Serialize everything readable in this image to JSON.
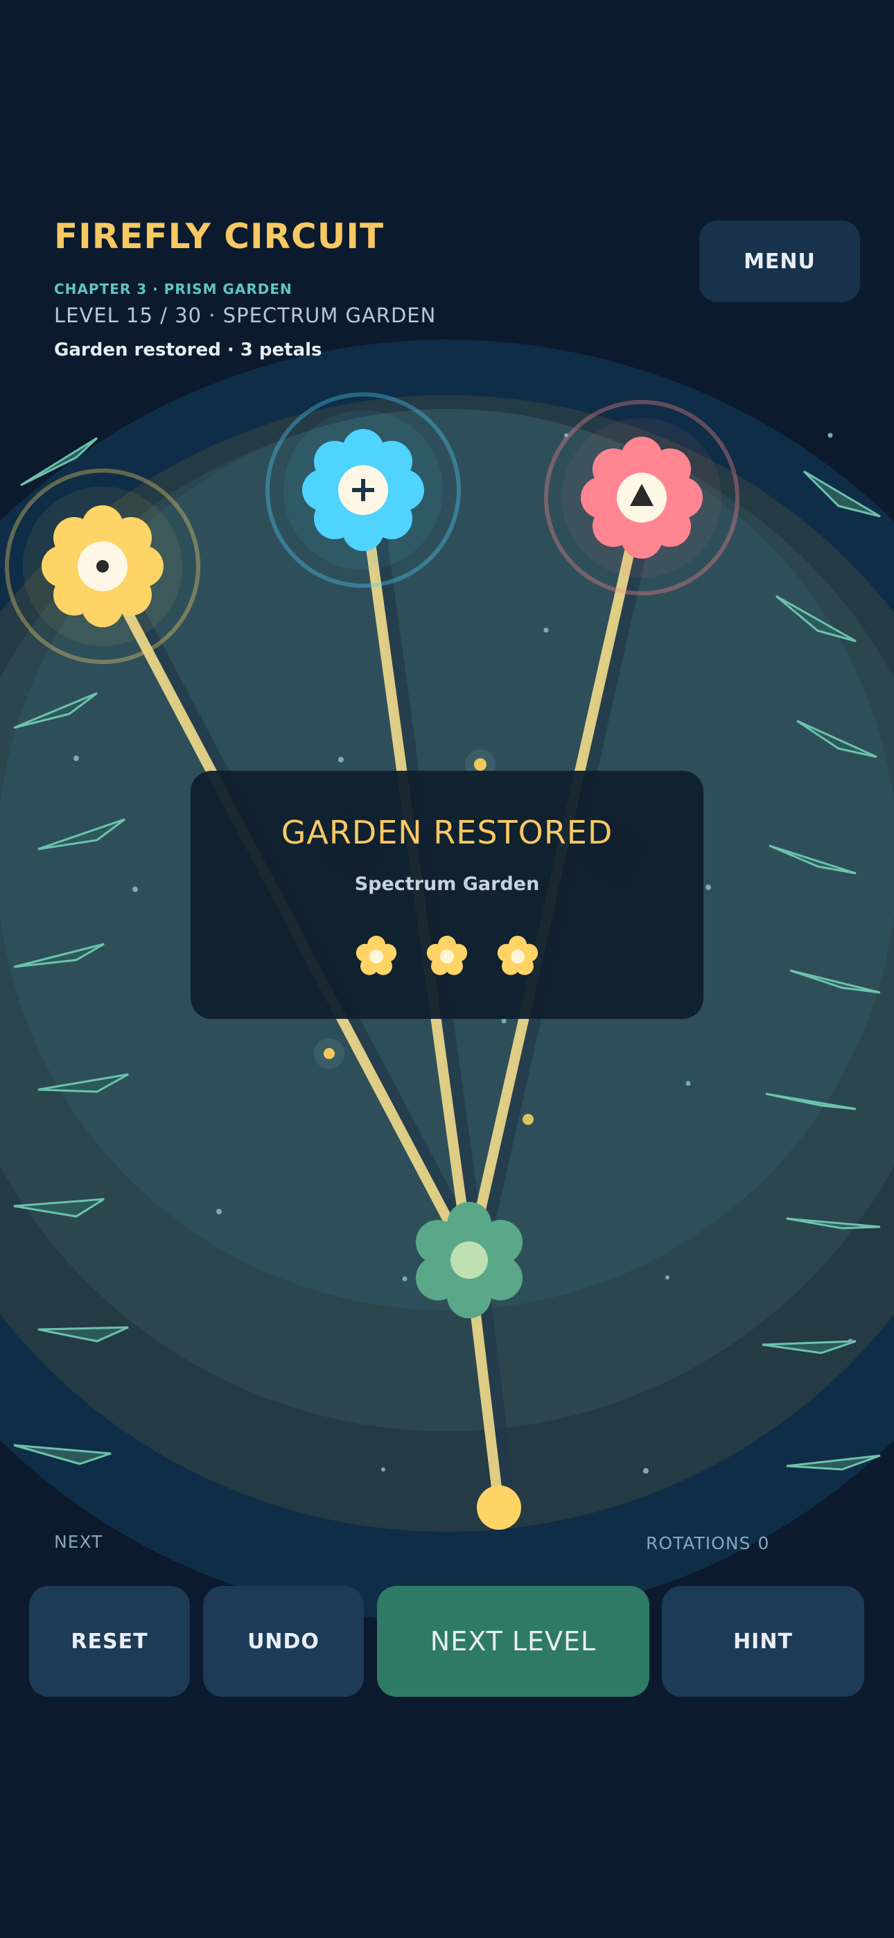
{
  "header": {
    "title": "FIREFLY CIRCUIT",
    "chapter": "CHAPTER 3 · PRISM GARDEN",
    "level": "LEVEL 15 / 30 · SPECTRUM GARDEN",
    "status": "Garden restored · 3 petals",
    "menu_label": "MENU"
  },
  "board": {
    "flowers": [
      {
        "color": "#ffd466",
        "icon": "dot-icon"
      },
      {
        "color": "#4fd3ff",
        "icon": "plus-icon"
      },
      {
        "color": "#ff8591",
        "icon": "triangle-icon"
      }
    ],
    "beam_color": "#eed98a",
    "hub_color": "#5aa888",
    "source_color": "#ffd466"
  },
  "modal": {
    "title": "GARDEN RESTORED",
    "subtitle": "Spectrum Garden",
    "petals_earned": 3,
    "petal_color": "#ffd466"
  },
  "footer": {
    "next_label": "NEXT",
    "rotations_label": "ROTATIONS",
    "rotations_value": "0"
  },
  "buttons": {
    "reset": "RESET",
    "undo": "UNDO",
    "next_level": "NEXT LEVEL",
    "hint": "HINT"
  }
}
